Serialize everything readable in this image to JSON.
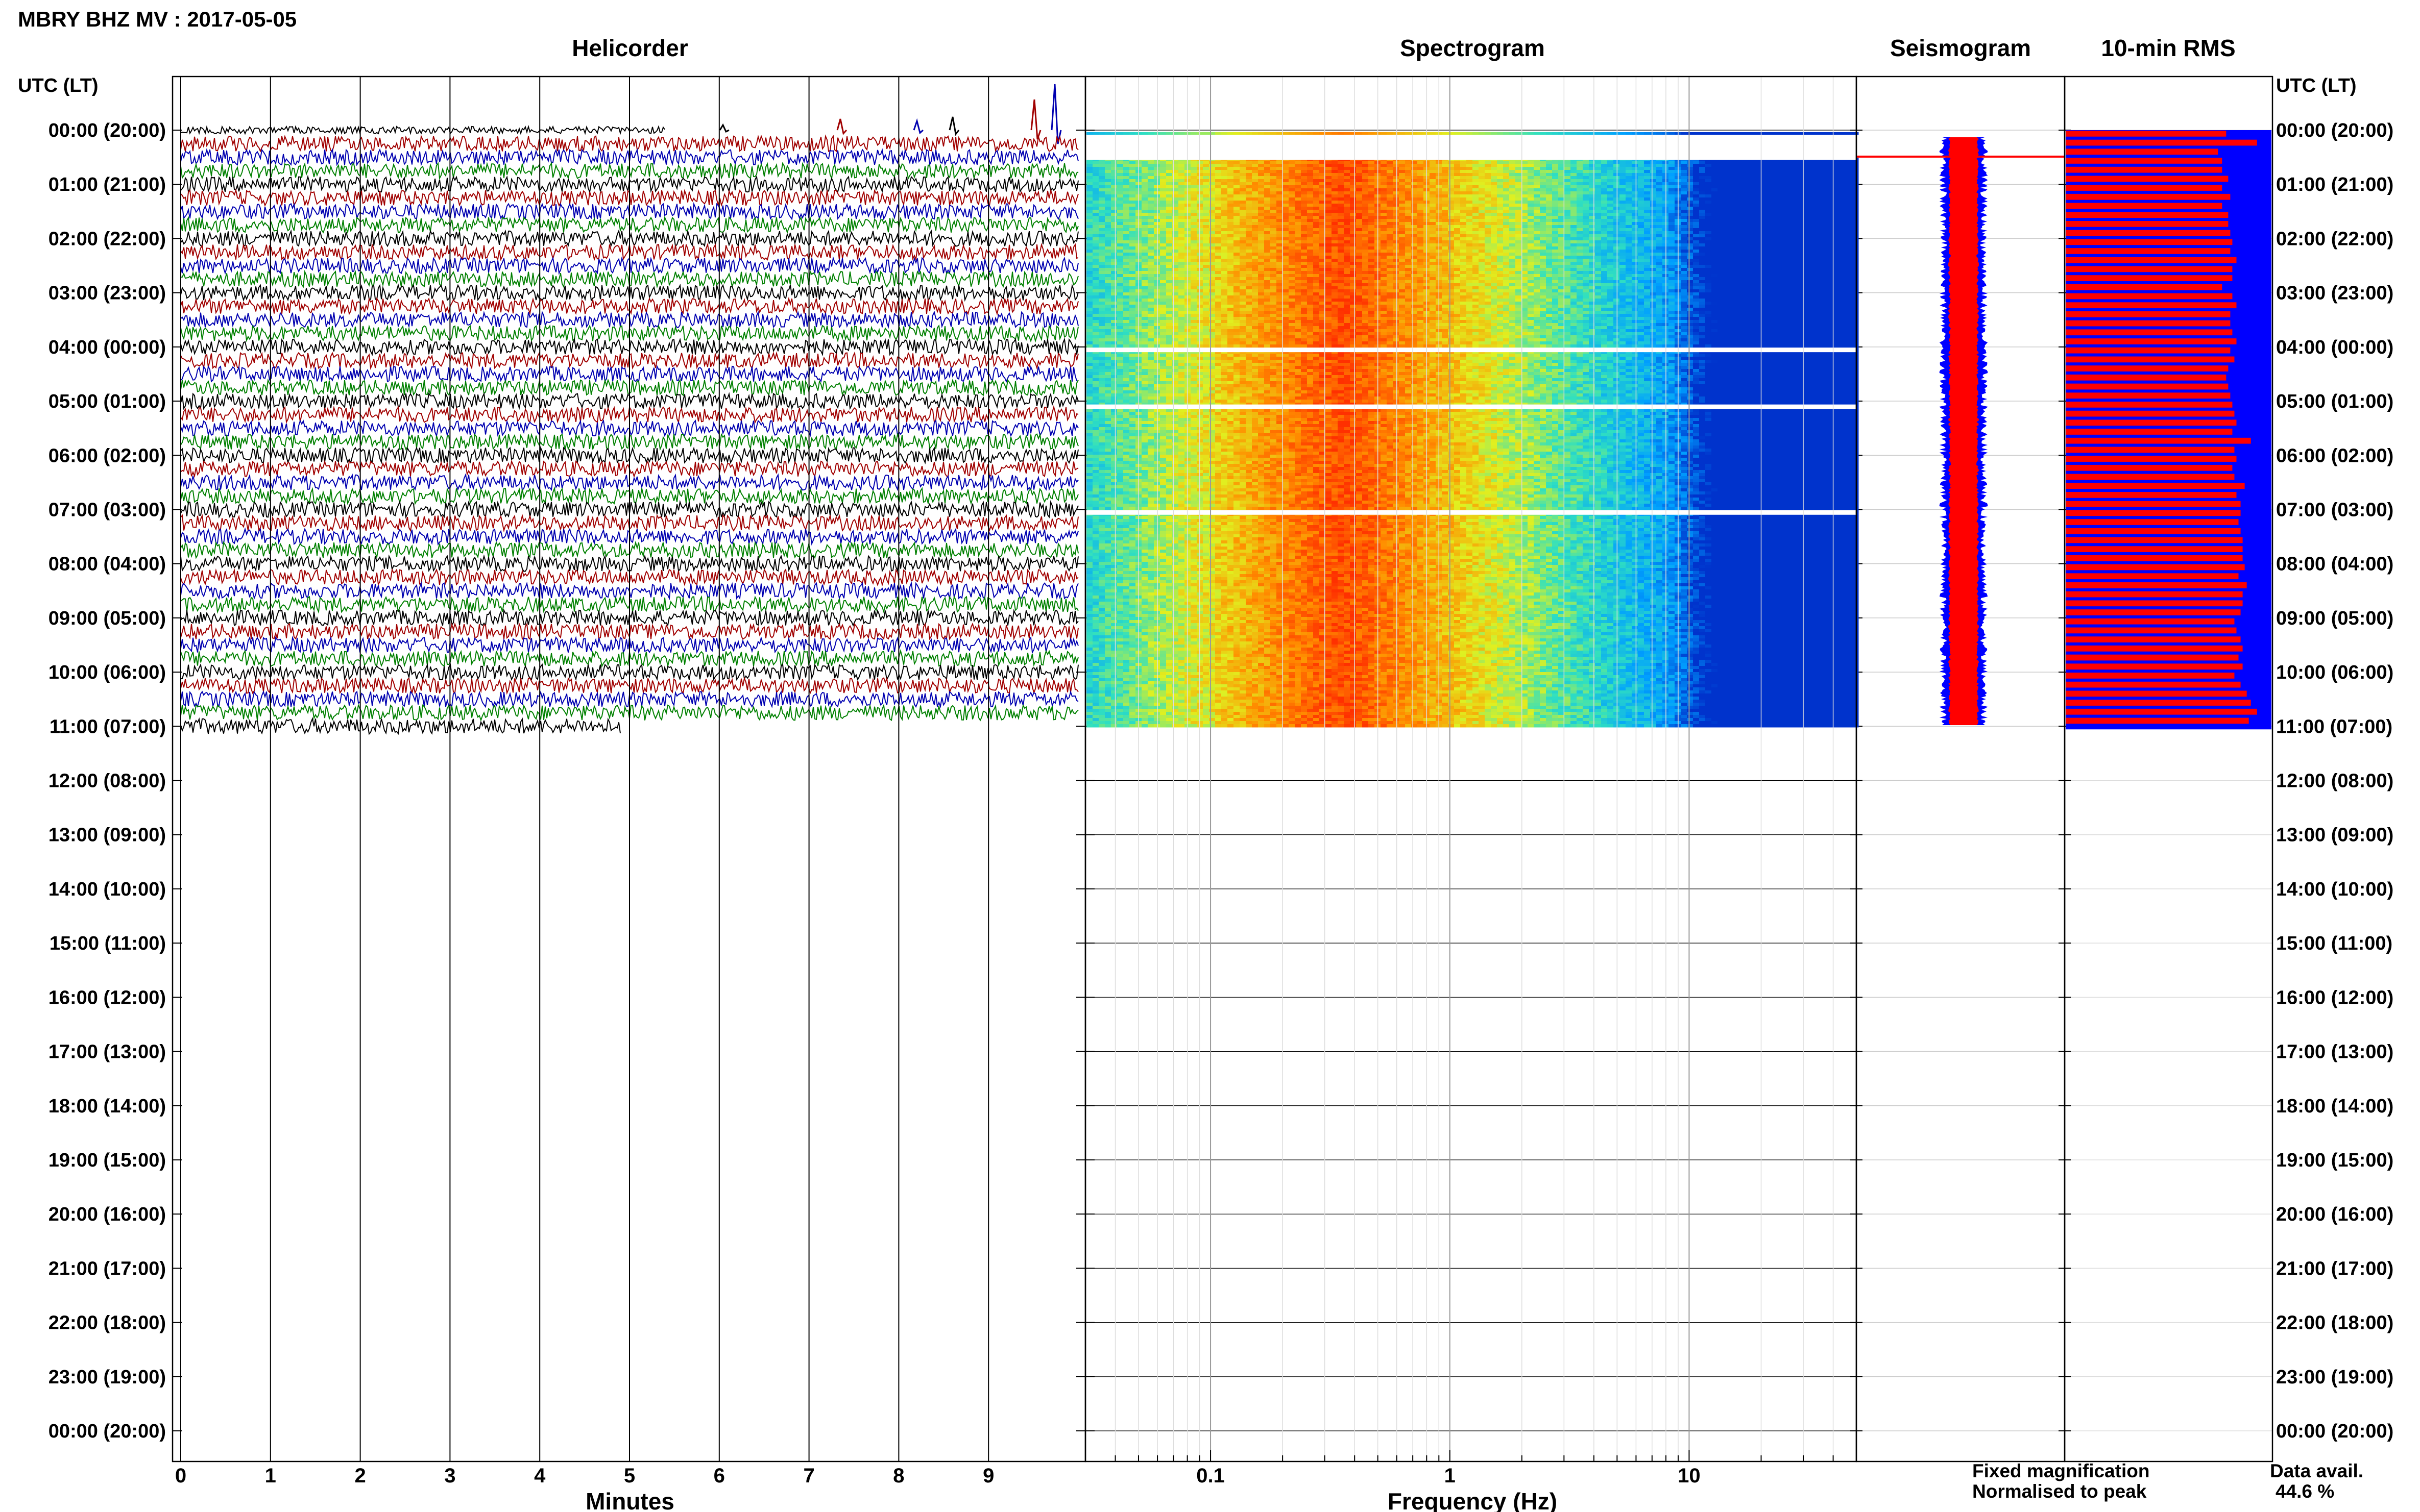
{
  "title": "MBRY BHZ MV : 2017-05-05",
  "panels": {
    "helicorder": "Helicorder",
    "spectrogram": "Spectrogram",
    "seismogram": "Seismogram",
    "rms": "10-min RMS"
  },
  "time_axis": {
    "header_left": "UTC (LT)",
    "header_right": "UTC (LT)",
    "labels": [
      "00:00 (20:00)",
      "01:00 (21:00)",
      "02:00 (22:00)",
      "03:00 (23:00)",
      "04:00 (00:00)",
      "05:00 (01:00)",
      "06:00 (02:00)",
      "07:00 (03:00)",
      "08:00 (04:00)",
      "09:00 (05:00)",
      "10:00 (06:00)",
      "11:00 (07:00)",
      "12:00 (08:00)",
      "13:00 (09:00)",
      "14:00 (10:00)",
      "15:00 (11:00)",
      "16:00 (12:00)",
      "17:00 (13:00)",
      "18:00 (14:00)",
      "19:00 (15:00)",
      "20:00 (16:00)",
      "21:00 (17:00)",
      "22:00 (18:00)",
      "23:00 (19:00)",
      "00:00 (20:00)"
    ]
  },
  "helicorder": {
    "xlabel": "Minutes",
    "ticks": [
      "0",
      "1",
      "2",
      "3",
      "4",
      "5",
      "6",
      "7",
      "8",
      "9"
    ],
    "trace_colors": [
      "#000000",
      "#a00000",
      "#0000b0",
      "#008000"
    ]
  },
  "spectrogram": {
    "xlabel": "Frequency (Hz)",
    "ticks": [
      "0.1",
      "1",
      "10"
    ],
    "colormap": [
      "#0033cc",
      "#00a0ff",
      "#30e0c0",
      "#e0f020",
      "#ff9000",
      "#ff3000"
    ]
  },
  "legend": {
    "fixed": "Fixed magnification",
    "normalised": "Normalised to peak",
    "fixed_color": "#0000ff",
    "normalised_color": "#ff0000"
  },
  "data_avail": {
    "label": "Data avail.",
    "value": "44.6 %"
  },
  "chart_data": {
    "type": "heatmap",
    "title": "MBRY BHZ MV : 2017-05-05",
    "ylabel": "UTC (LT)",
    "time_range_hours": [
      0,
      24
    ],
    "data_end_hour": 11.0,
    "helicorder_xlim_minutes": [
      0,
      10
    ],
    "spectrogram_xlim_hz": [
      0.03,
      50
    ],
    "spectrogram_xscale": "log",
    "spectrogram_gap_hours": [
      0.5,
      4.05,
      5.1,
      7.05
    ],
    "spectrogram_peak_band_hz": [
      0.2,
      0.6
    ],
    "rms_bar_fraction_10min": [
      0.78,
      0.93,
      0.74,
      0.76,
      0.76,
      0.79,
      0.76,
      0.8,
      0.76,
      0.79,
      0.79,
      0.8,
      0.81,
      0.8,
      0.83,
      0.81,
      0.81,
      0.76,
      0.81,
      0.83,
      0.8,
      0.8,
      0.81,
      0.83,
      0.8,
      0.82,
      0.79,
      0.78,
      0.79,
      0.8,
      0.81,
      0.82,
      0.83,
      0.81,
      0.9,
      0.82,
      0.83,
      0.81,
      0.82,
      0.87,
      0.83,
      0.85,
      0.85,
      0.84,
      0.85,
      0.86,
      0.86,
      0.86,
      0.87,
      0.84,
      0.88,
      0.86,
      0.86,
      0.85,
      0.82,
      0.83,
      0.85,
      0.86,
      0.84,
      0.86,
      0.82,
      0.85,
      0.88,
      0.9,
      0.93,
      0.89
    ]
  }
}
